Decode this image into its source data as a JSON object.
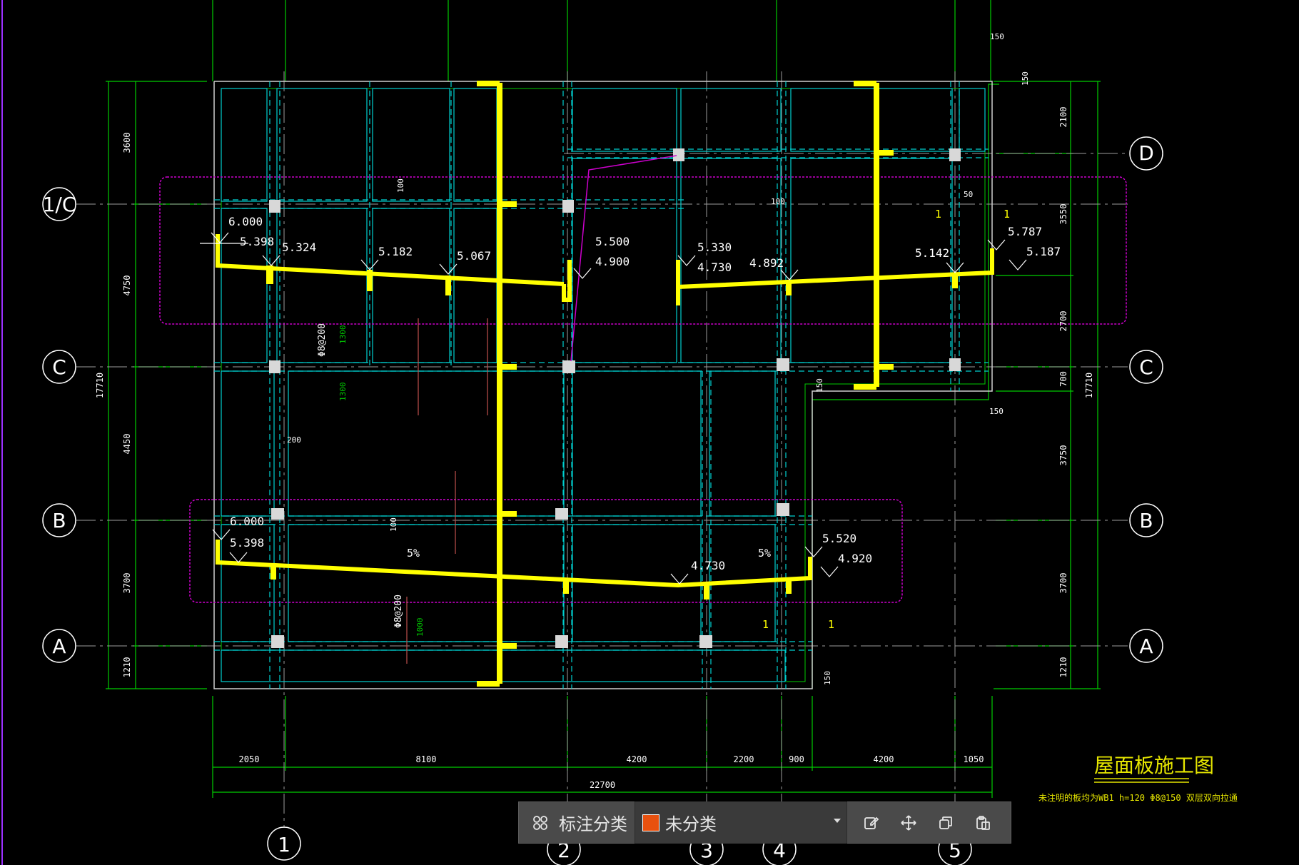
{
  "drawing": {
    "title": "屋面板施工图",
    "note": "未注明的板均为WB1  h=120  Φ8@150 双层双向拉通"
  },
  "axes": {
    "horizontal": [
      "D",
      "1/C",
      "C",
      "B",
      "A"
    ],
    "vertical": [
      "1",
      "2",
      "3",
      "4",
      "5"
    ]
  },
  "dimensions": {
    "bottom": [
      "2050",
      "8100",
      "4200",
      "2200",
      "900",
      "4200",
      "1050"
    ],
    "bottom_total": "22700",
    "left": [
      "3600",
      "4750",
      "4450",
      "3700",
      "1210"
    ],
    "left_total": "17710",
    "right": [
      "2100",
      "3550",
      "2700",
      "700",
      "3750",
      "3700",
      "1210"
    ],
    "right_total": "17710",
    "small": [
      "150",
      "150",
      "150",
      "150",
      "150",
      "100",
      "100",
      "100",
      "50",
      "200"
    ]
  },
  "elevations": {
    "top": [
      "6.000",
      "5.398",
      "5.324",
      "5.182",
      "5.067",
      "5.500",
      "4.900",
      "5.330",
      "4.730",
      "4.892",
      "5.142",
      "5.787",
      "5.187"
    ],
    "bottom": [
      "6.000",
      "5.398",
      "4.730",
      "5.520",
      "4.920"
    ]
  },
  "slopes": [
    "5%",
    "5%"
  ],
  "rebar": [
    "Φ8@200",
    "Φ8@200"
  ],
  "rebar_len": [
    "1300",
    "1300",
    "1000"
  ],
  "slab_marks": [
    "1",
    "1",
    "1",
    "1"
  ],
  "toolbar": {
    "category_label": "标注分类",
    "category_value": "未分类",
    "swatch_color": "#e8510f"
  },
  "colors": {
    "grid": "#9b9b9b",
    "dimension": "#00cc00",
    "beam": "#00d0d0",
    "yellow": "#ffff00",
    "magenta": "#cc00cc",
    "text": "#ffffff"
  }
}
